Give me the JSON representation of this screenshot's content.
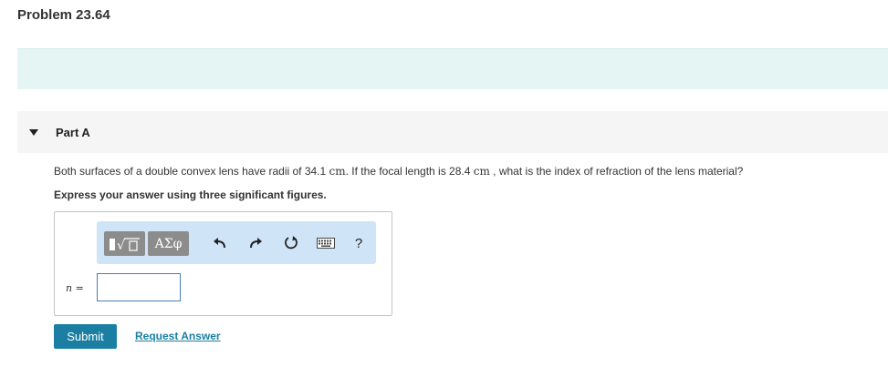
{
  "problem": {
    "title": "Problem 23.64"
  },
  "part": {
    "label": "Part A"
  },
  "question": {
    "text_1": "Both surfaces of a double convex lens have radii of 34.1 ",
    "unit_1": "cm",
    "text_2": ". If the focal length is 28.4  ",
    "unit_2": "cm",
    "text_3": " , what is the index of refraction of the lens material?"
  },
  "instruction": "Express your answer using three significant figures.",
  "toolbar": {
    "templates_icon": "templates-icon",
    "symbols_label": "ΑΣφ",
    "undo_icon": "undo-icon",
    "redo_icon": "redo-icon",
    "reset_icon": "reset-icon",
    "keyboard_icon": "keyboard-icon",
    "help_label": "?"
  },
  "answer": {
    "variable_label": "n =",
    "value": ""
  },
  "actions": {
    "submit_label": "Submit",
    "request_label": "Request Answer"
  },
  "colors": {
    "accent": "#1a7fa3",
    "toolbar_bg": "#cfe4f7",
    "intro_band": "#e4f5f4"
  }
}
